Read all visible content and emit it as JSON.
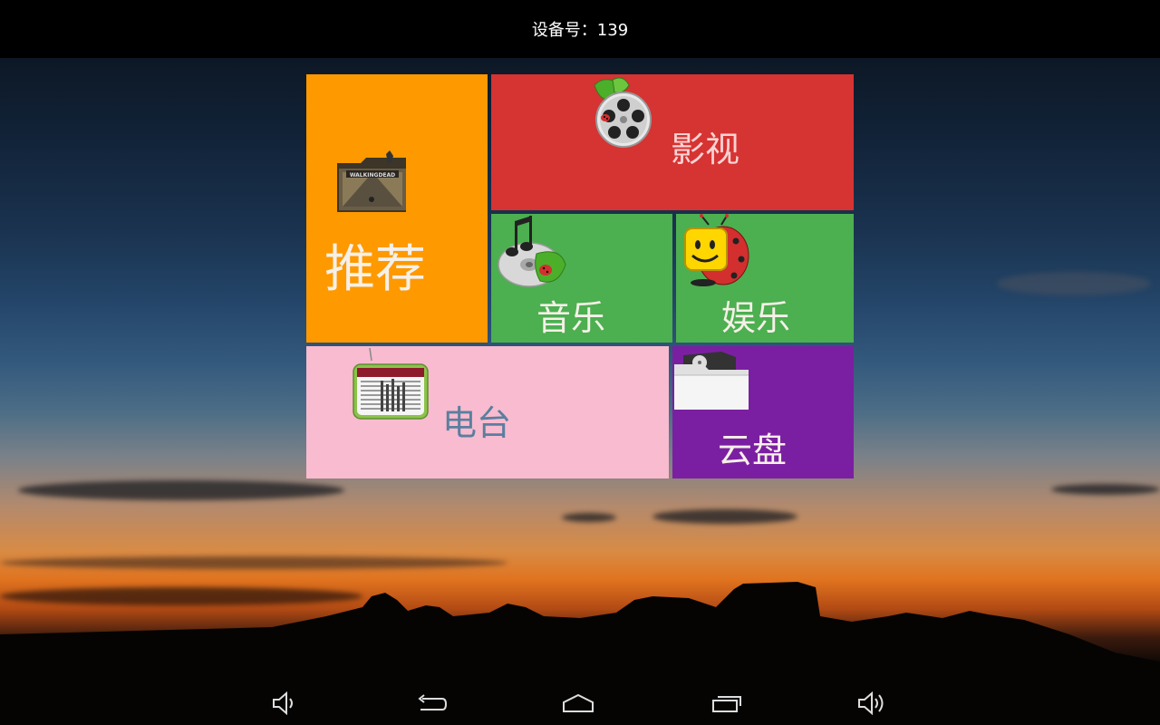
{
  "status_bar": {
    "device_label": "设备号：139"
  },
  "tiles": {
    "recommend": {
      "label": "推荐",
      "icon": "walking-dead-folder-icon",
      "color": "#ff9900"
    },
    "video": {
      "label": "影视",
      "icon": "film-reel-icon",
      "color": "#d63333"
    },
    "music": {
      "label": "音乐",
      "icon": "music-cd-icon",
      "color": "#4caf50"
    },
    "entertainment": {
      "label": "娱乐",
      "icon": "smiley-tv-icon",
      "color": "#4caf50"
    },
    "radio": {
      "label": "电台",
      "icon": "radio-icon",
      "color": "#f8bbd0",
      "label_color": "#5a7f9e"
    },
    "cloud": {
      "label": "云盘",
      "icon": "cloud-folder-icon",
      "color": "#7b1fa2"
    }
  },
  "nav_bar": {
    "buttons": [
      "volume-down-icon",
      "back-icon",
      "home-icon",
      "recent-apps-icon",
      "volume-up-icon"
    ]
  }
}
